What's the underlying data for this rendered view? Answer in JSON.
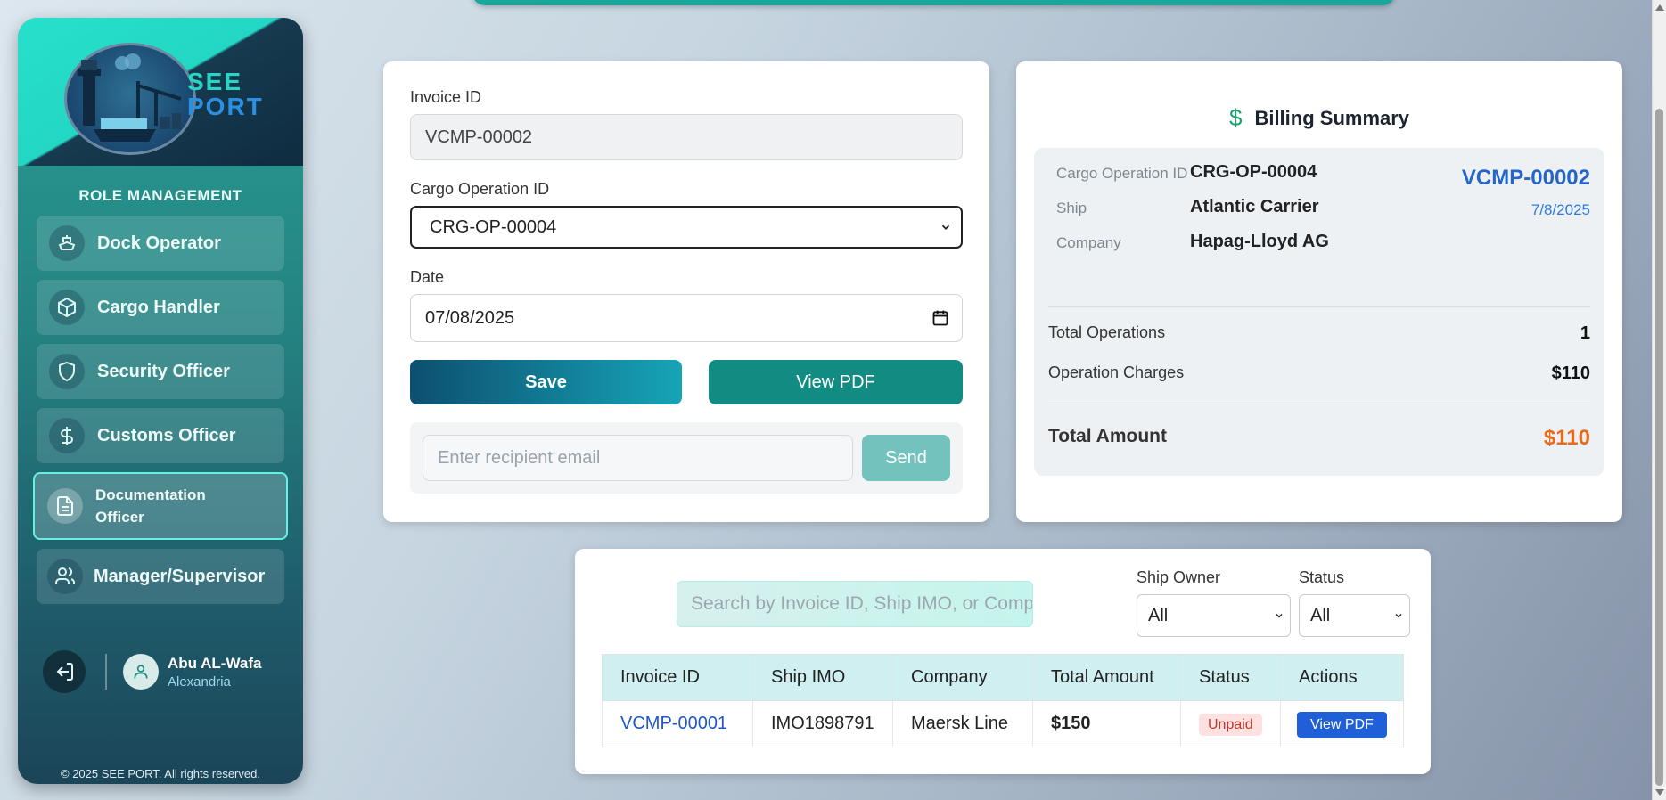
{
  "brand": {
    "line1": "SEE",
    "line2": "PORT"
  },
  "sidebar": {
    "heading": "ROLE MANAGEMENT",
    "items": [
      {
        "label": "Dock Operator",
        "icon": "ship-icon"
      },
      {
        "label": "Cargo Handler",
        "icon": "box-icon"
      },
      {
        "label": "Security Officer",
        "icon": "shield-icon"
      },
      {
        "label": "Customs Officer",
        "icon": "dollar-icon"
      },
      {
        "label": "Documentation Officer",
        "icon": "document-icon",
        "active": true
      },
      {
        "label": "Manager/Supervisor",
        "icon": "users-icon"
      }
    ],
    "user": {
      "name": "Abu AL-Wafa",
      "location": "Alexandria"
    },
    "copyright": "© 2025 SEE PORT. All rights reserved."
  },
  "form": {
    "invoice_label": "Invoice ID",
    "invoice_value": "VCMP-00002",
    "cargo_label": "Cargo Operation ID",
    "cargo_value": "CRG-OP-00004",
    "date_label": "Date",
    "date_value": "07/08/2025",
    "save_label": "Save",
    "view_pdf_label": "View PDF",
    "email_placeholder": "Enter recipient email",
    "send_label": "Send"
  },
  "billing": {
    "title": "Billing Summary",
    "cargo_op_label": "Cargo Operation ID",
    "cargo_op_value": "CRG-OP-00004",
    "ship_label": "Ship",
    "ship_value": "Atlantic Carrier",
    "company_label": "Company",
    "company_value": "Hapag-Lloyd AG",
    "invoice_id": "VCMP-00002",
    "invoice_date": "7/8/2025",
    "total_ops_label": "Total Operations",
    "total_ops_value": "1",
    "op_charges_label": "Operation Charges",
    "op_charges_value": "$110",
    "total_amount_label": "Total Amount",
    "total_amount_value": "$110"
  },
  "list": {
    "search_placeholder": "Search by Invoice ID, Ship IMO, or Company",
    "ship_owner_label": "Ship Owner",
    "ship_owner_value": "All",
    "status_label": "Status",
    "status_value": "All",
    "columns": [
      "Invoice ID",
      "Ship IMO",
      "Company",
      "Total Amount",
      "Status",
      "Actions"
    ],
    "rows": [
      {
        "invoice_id": "VCMP-00001",
        "ship_imo": "IMO1898791",
        "company": "Maersk Line",
        "total": "$150",
        "status": "Unpaid",
        "action": "View PDF"
      }
    ]
  },
  "colors": {
    "accent": "#128c83",
    "link": "#2565c9",
    "total": "#ea6a1a"
  }
}
